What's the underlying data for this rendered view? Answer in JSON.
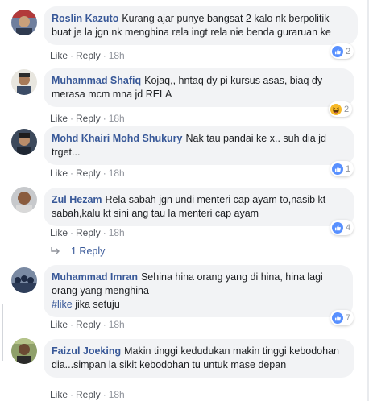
{
  "comments": [
    {
      "author": "Roslin Kazuto",
      "text": "Kurang ajar punye bangsat 2 kalo nk berpolitik buat je la jgn nk menghina rela ingt rela nie benda guraruan ke",
      "like": "Like",
      "reply": "Reply",
      "time": "18h",
      "reaction_icon": "like-icon",
      "reaction_count": "2"
    },
    {
      "author": "Muhammad Shafiq",
      "text": "Kojaq,, hntaq dy pi kursus asas, biaq dy merasa mcm mna jd RELA",
      "like": "Like",
      "reply": "Reply",
      "time": "18h",
      "reaction_icon": "haha-icon",
      "reaction_count": "2"
    },
    {
      "author": "Mohd Khairi Mohd Shukury",
      "text": "Nak tau pandai ke x.. suh dia jd trget...",
      "like": "Like",
      "reply": "Reply",
      "time": "18h",
      "reaction_icon": "like-icon",
      "reaction_count": "1"
    },
    {
      "author": "Zul Hezam",
      "text": "Rela sabah jgn undi menteri cap ayam to,nasib kt sabah,kalu kt sini ang tau la menteri cap ayam",
      "like": "Like",
      "reply": "Reply",
      "time": "18h",
      "reaction_icon": "like-icon",
      "reaction_count": "4",
      "replies_label": "1 Reply"
    },
    {
      "author": "Muhammad Imran",
      "text": "Sehina hina orang yang di hina, hina lagi orang yang menghina",
      "hashtag": "#like",
      "text_after": " jika setuju",
      "like": "Like",
      "reply": "Reply",
      "time": "18h",
      "reaction_icon": "like-icon",
      "reaction_count": "7"
    },
    {
      "author": "Faizul Joeking",
      "text": "Makin tinggi kedudukan makin tinggi kebodohan dia...simpan la sikit kebodohan tu untuk mase depan",
      "like": "Like",
      "reply": "Reply",
      "time": "18h"
    }
  ],
  "colors": {
    "link": "#385898",
    "bubble": "#f2f3f5",
    "meta": "#90949c",
    "like_blue": "#5890ff",
    "haha_yellow": "#f7b928"
  }
}
